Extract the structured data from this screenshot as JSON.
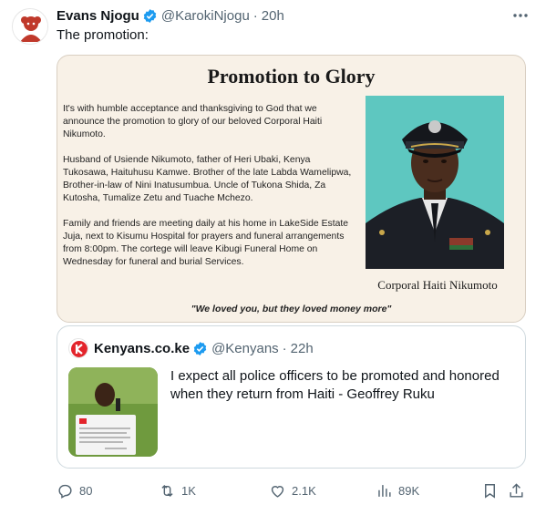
{
  "tweet": {
    "author_name": "Evans Njogu",
    "handle": "@KarokiNjogu",
    "separator": "·",
    "time": "20h",
    "text": "The promotion:"
  },
  "card": {
    "title": "Promotion to Glory",
    "paragraph_1": "It's with humble acceptance and thanksgiving to God that we announce the promotion to glory of our beloved Corporal Haiti Nikumoto.",
    "paragraph_2": "Husband of Usiende Nikumoto, father of Heri Ubaki, Kenya Tukosawa, Haituhusu Kamwe. Brother of the late Labda Wamelipwa, Brother-in-law of Nini Inatusumbua. Uncle of Tukona Shida, Za Kutosha, Tumalize Zetu and Tuache Mchezo.",
    "paragraph_3": "Family and friends are meeting daily at his home in LakeSide Estate Juja, next to Kisumu Hospital for prayers and funeral arrangements from 8:00pm. The cortege will leave Kibugi Funeral Home on Wednesday for funeral and burial Services.",
    "caption": "Corporal Haiti Nikumoto",
    "quote": "\"We loved you, but they loved money more\""
  },
  "quoted_tweet": {
    "author_name": "Kenyans.co.ke",
    "handle": "@Kenyans",
    "separator": "·",
    "time": "22h",
    "text": "I expect all police officers to be promoted and honored when they return from Haiti - Geoffrey Ruku"
  },
  "actions": {
    "replies": "80",
    "retweets": "1K",
    "likes": "2.1K",
    "views": "89K"
  },
  "icons": {
    "verified": "verified-badge-icon",
    "more": "more-options-icon",
    "reply": "reply-icon",
    "retweet": "retweet-icon",
    "like": "heart-icon",
    "views": "views-bar-chart-icon",
    "bookmark": "bookmark-icon",
    "share": "share-icon"
  },
  "colors": {
    "verified_blue": "#1d9bf0",
    "secondary_text": "#536471",
    "card_background": "#f8f1e7",
    "portrait_background": "#5ec7c0"
  }
}
